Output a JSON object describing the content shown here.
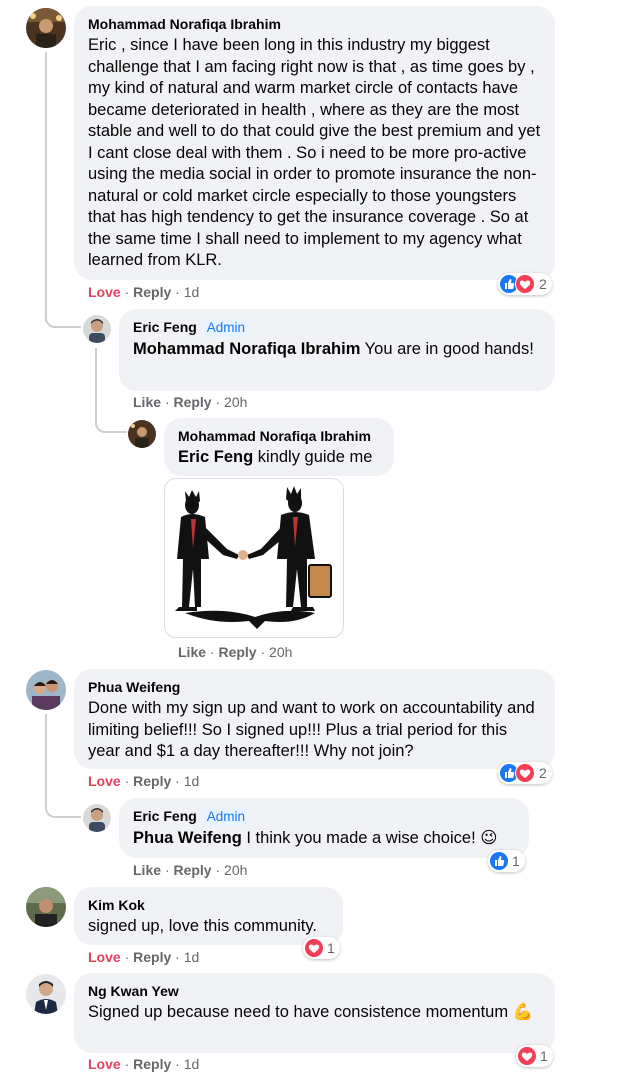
{
  "comments": [
    {
      "author": "Mohammad Norafiqa Ibrahim",
      "text": "Eric , since I have been long in this industry my biggest challenge that I am facing right now is that , as time goes by , my kind of natural and warm market circle of contacts have became deteriorated in health , where as they are the most stable and well to do that could give the best premium and yet I cant close deal with them . So i need to be more pro-active using the media social in order to promote insurance the non-natural or cold market circle especially to those youngsters that has high tendency to get the insurance coverage . So at the same time I shall need to implement to my agency what learned from KLR.",
      "reaction_label": "Love",
      "reply_label": "Reply",
      "time": "1d",
      "reaction_count": "2"
    },
    {
      "author": "Eric Feng",
      "badge": "Admin",
      "mention": "Mohammad Norafiqa Ibrahim",
      "text": " You are in good hands!",
      "reaction_label": "Like",
      "reply_label": "Reply",
      "time": "20h"
    },
    {
      "author": "Mohammad Norafiqa Ibrahim",
      "mention": "Eric Feng",
      "text": " kindly guide me",
      "reaction_label": "Like",
      "reply_label": "Reply",
      "time": "20h"
    },
    {
      "author": "Phua Weifeng",
      "text": "Done with my sign up and want to work on accountability and limiting belief!!! So I signed up!!! Plus a trial period for this year and $1 a day thereafter!!! Why not join?",
      "reaction_label": "Love",
      "reply_label": "Reply",
      "time": "1d",
      "reaction_count": "2"
    },
    {
      "author": "Eric Feng",
      "badge": "Admin",
      "mention": "Phua Weifeng",
      "text": " I think you made a wise choice! 😉",
      "reaction_label": "Like",
      "reply_label": "Reply",
      "time": "20h",
      "reaction_count": "1"
    },
    {
      "author": "Kim Kok",
      "text": "signed up, love this community.",
      "reaction_label": "Love",
      "reply_label": "Reply",
      "time": "1d",
      "reaction_count": "1"
    },
    {
      "author": "Ng Kwan Yew",
      "text": "Signed up because need to have consistence momentum 💪",
      "reaction_label": "Love",
      "reply_label": "Reply",
      "time": "1d",
      "reaction_count": "1"
    }
  ],
  "icons": {
    "like": "like-icon",
    "love": "love-icon",
    "handshake": "handshake-image"
  },
  "colors": {
    "like_blue": "#1877f2",
    "love_red": "#f33e58",
    "love_text": "#e4435f",
    "bubble_gray": "#f0f2f5",
    "meta_gray": "#65676b"
  }
}
